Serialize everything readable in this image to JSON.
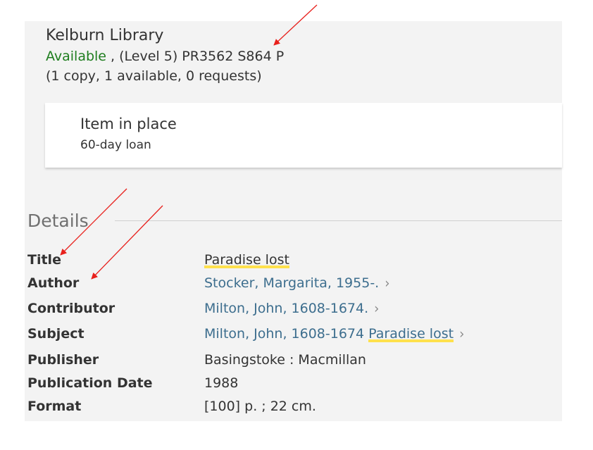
{
  "holding": {
    "library": "Kelburn Library",
    "availability": "Available",
    "location": " , (Level 5) PR3562 S864 P",
    "copies": "(1 copy, 1 available, 0 requests)"
  },
  "item": {
    "status": "Item in place",
    "policy": "60-day loan"
  },
  "details": {
    "heading": "Details",
    "title_label": "Title",
    "title_value": "Paradise lost",
    "author_label": "Author",
    "author_value": "Stocker, Margarita, 1955-.",
    "contributor_label": "Contributor",
    "contributor_value": "Milton, John, 1608-1674.",
    "subject_label": "Subject",
    "subject_value_a": "Milton, John, 1608-1674 ",
    "subject_value_b": "Paradise lost",
    "publisher_label": "Publisher",
    "publisher_value": "Basingstoke : Macmillan",
    "pubdate_label": "Publication Date",
    "pubdate_value": "1988",
    "format_label": "Format",
    "format_value": "[100] p. ; 22 cm."
  },
  "icons": {
    "chevron": "›"
  },
  "colors": {
    "available": "#1e7d1e",
    "link": "#3d6e8e",
    "highlight": "#ffe14d",
    "annotation_arrow": "#e8201c"
  }
}
